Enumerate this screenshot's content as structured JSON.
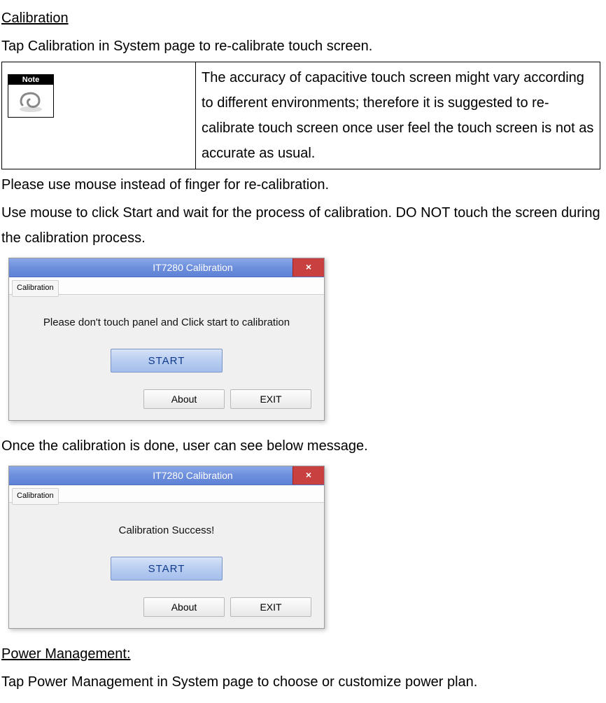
{
  "headings": {
    "calibration": "Calibration",
    "power_management": "Power Management:"
  },
  "paragraphs": {
    "tap_calibration": "Tap Calibration in System page to re-calibrate touch screen.",
    "use_mouse_instead": "Please use mouse instead of finger for re-calibration.",
    "use_mouse_click_start": "Use mouse to click Start and wait for the process of calibration. DO NOT touch the screen during the calibration process.",
    "once_done": "Once the calibration is done, user can see below message.",
    "tap_power_management": "Tap Power Management in System page to choose or customize power plan."
  },
  "note": {
    "header": "Note",
    "text": "The accuracy of capacitive touch screen might vary according to different environments; therefore it is suggested to re-calibrate touch screen once user feel the touch screen is not as accurate as usual."
  },
  "calibration_dialog": {
    "title": "IT7280 Calibration",
    "menu": "Calibration",
    "close_glyph": "×",
    "screen1_message": "Please don't touch panel and Click start to calibration",
    "screen2_message": "Calibration Success!",
    "start_btn": "START",
    "about_btn": "About",
    "exit_btn": "EXIT"
  }
}
